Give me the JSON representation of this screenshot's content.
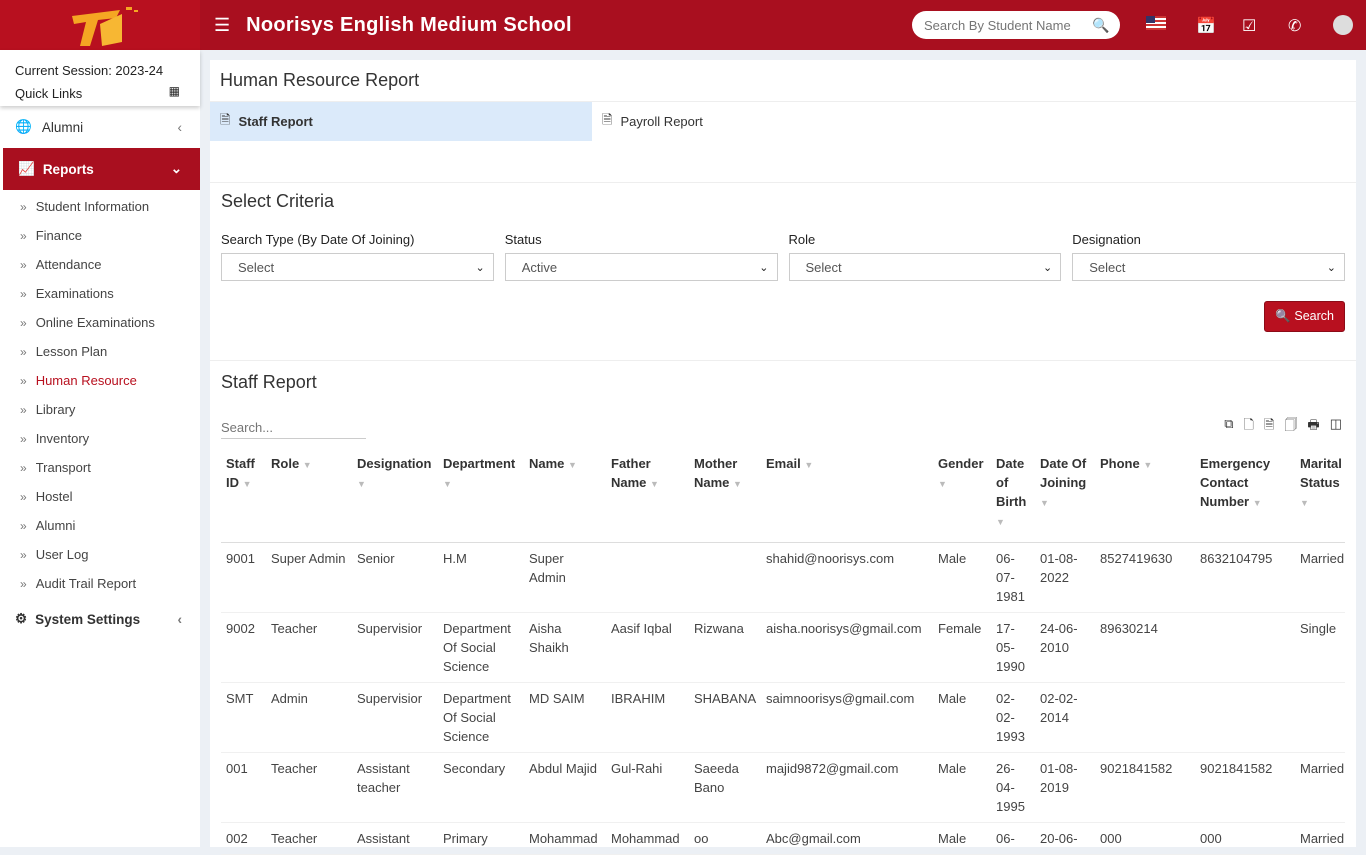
{
  "header": {
    "title": "Noorisys English Medium School",
    "search_placeholder": "Search By Student Name"
  },
  "sidebar": {
    "session": "Current Session: 2023-24",
    "quick_links": "Quick Links",
    "alumni": "Alumni",
    "reports": "Reports",
    "system_settings": "System Settings",
    "sub": [
      "Student Information",
      "Finance",
      "Attendance",
      "Examinations",
      "Online Examinations",
      "Lesson Plan",
      "Human Resource",
      "Library",
      "Inventory",
      "Transport",
      "Hostel",
      "Alumni",
      "User Log",
      "Audit Trail Report"
    ]
  },
  "main": {
    "title": "Human Resource Report",
    "tabs": [
      "Staff Report",
      "Payroll Report"
    ],
    "criteria_title": "Select Criteria",
    "fields": [
      {
        "label": "Search Type (By Date Of Joining)",
        "value": "Select"
      },
      {
        "label": "Status",
        "value": "Active"
      },
      {
        "label": "Role",
        "value": "Select"
      },
      {
        "label": "Designation",
        "value": "Select"
      }
    ],
    "search_button": "Search",
    "report_title": "Staff Report",
    "table_search_placeholder": "Search...",
    "columns": [
      "Staff ID",
      "Role",
      "Designation",
      "Department",
      "Name",
      "Father Name",
      "Mother Name",
      "Email",
      "Gender",
      "Date of Birth",
      "Date Of Joining",
      "Phone",
      "Emergency Contact Number",
      "Marital Status"
    ],
    "rows": [
      [
        "9001",
        "Super Admin",
        "Senior",
        "H.M",
        "Super Admin",
        "",
        "",
        "shahid@noorisys.com",
        "Male",
        "06-07-1981",
        "01-08-2022",
        "8527419630",
        "8632104795",
        "Married"
      ],
      [
        "9002",
        "Teacher",
        "Supervisior",
        "Department Of Social Science",
        "Aisha Shaikh",
        "Aasif Iqbal",
        "Rizwana",
        "aisha.noorisys@gmail.com",
        "Female",
        "17-05-1990",
        "24-06-2010",
        "89630214",
        "",
        "Single"
      ],
      [
        "SMT",
        "Admin",
        "Supervisior",
        "Department Of Social Science",
        "MD SAIM",
        "IBRAHIM",
        "SHABANA",
        "saimnoorisys@gmail.com",
        "Male",
        "02-02-1993",
        "02-02-2014",
        "",
        "",
        ""
      ],
      [
        "001",
        "Teacher",
        "Assistant teacher",
        "Secondary",
        "Abdul Majid",
        "Gul-Rahi",
        "Saeeda Bano",
        "majid9872@gmail.com",
        "Male",
        "26-04-1995",
        "01-08-2019",
        "9021841582",
        "9021841582",
        "Married"
      ],
      [
        "002",
        "Teacher",
        "Assistant",
        "Primary",
        "Mohammad",
        "Mohammad",
        "oo",
        "Abc@gmail.com",
        "Male",
        "06-",
        "20-06-",
        "000",
        "000",
        "Married"
      ]
    ]
  },
  "colors": {
    "brand": "#a90f1f",
    "tab_active": "#dbeafa"
  }
}
